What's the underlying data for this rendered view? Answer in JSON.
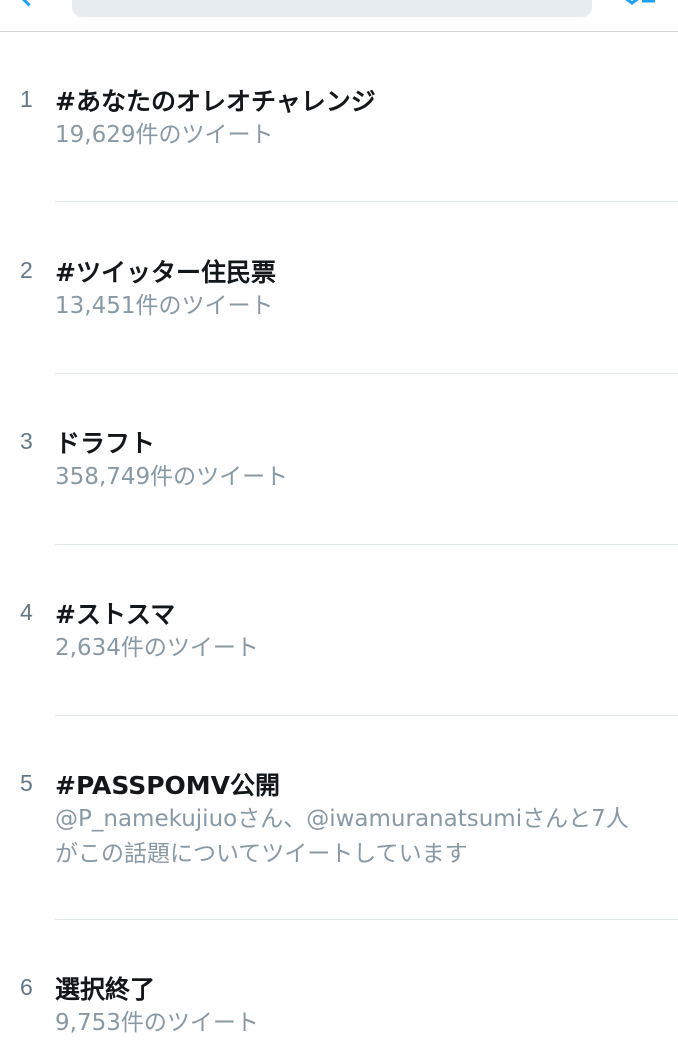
{
  "header": {
    "back_icon": "chevron-left-icon",
    "settings_icon": "settings-icon",
    "search_placeholder": "",
    "accent_color": "#1da1f2"
  },
  "trends": [
    {
      "rank": "1",
      "name": "#あなたのオレオチャレンジ",
      "meta": "19,629件のツイート"
    },
    {
      "rank": "2",
      "name": "#ツイッター住民票",
      "meta": "13,451件のツイート"
    },
    {
      "rank": "3",
      "name": "ドラフト",
      "meta": "358,749件のツイート"
    },
    {
      "rank": "4",
      "name": "#ストスマ",
      "meta": "2,634件のツイート"
    },
    {
      "rank": "5",
      "name": "#PASSPOMV公開",
      "meta": "@P_namekujiuoさん、@iwamuranatsumiさんと7人がこの話題についてツイートしています"
    },
    {
      "rank": "6",
      "name": "選択終了",
      "meta": "9,753件のツイート"
    }
  ]
}
